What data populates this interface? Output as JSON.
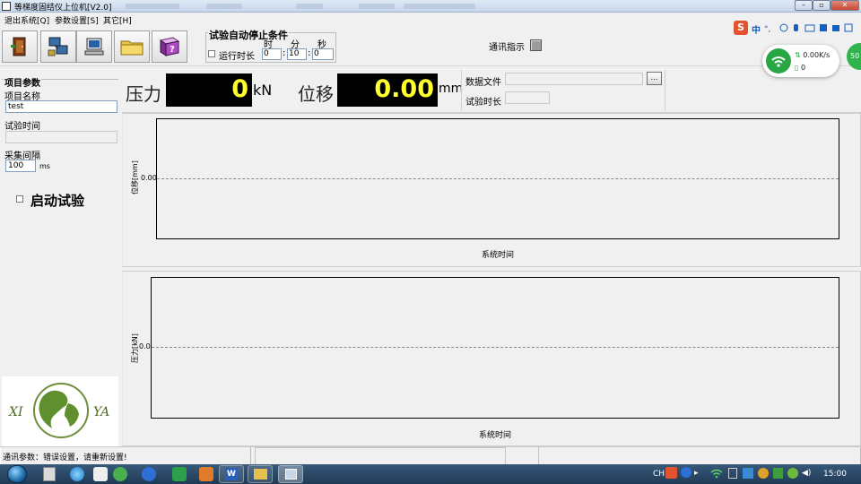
{
  "window": {
    "title": "等梯度固结仪上位机[V2.0]"
  },
  "menu": [
    {
      "label": "退出系统[Q]"
    },
    {
      "label": "参数设置[S]"
    },
    {
      "label": "其它[H]"
    }
  ],
  "toolbar": {
    "buttons": [
      {
        "icon": "exit-door-icon"
      },
      {
        "icon": "network-settings-icon"
      },
      {
        "icon": "computer-icon"
      },
      {
        "icon": "folder-icon"
      },
      {
        "icon": "help-book-icon"
      }
    ],
    "stop_condition": {
      "legend": "试验自动停止条件",
      "runtime_label": "运行时长",
      "hour_header": "时",
      "minute_header": "分",
      "second_header": "秒",
      "hour_value": "0",
      "minute_value": "10",
      "second_value": "0",
      "sep1": ":",
      "sep2": ":"
    },
    "comm_label": "通讯指示"
  },
  "tray_popup": {
    "ime_icon": "S",
    "ime_lang": "中",
    "upload_speed": "0.00K/s",
    "download_speed": "0",
    "ball_text": "50"
  },
  "project": {
    "legend": "项目参数",
    "name_label": "项目名称",
    "name_value": "test",
    "time_label": "试验时间",
    "time_value": "",
    "interval_label": "采集间隔",
    "interval_value": "100",
    "interval_unit": "ms",
    "start_label": "启动试验"
  },
  "readout": {
    "force_label": "压力",
    "force_value": "0",
    "force_unit": "kN",
    "disp_label": "位移",
    "disp_value": "0.00",
    "disp_unit": "mm"
  },
  "datafile": {
    "label": "数据文件",
    "value": "",
    "browse_label": "...",
    "duration_label": "试验时长",
    "duration_value": ""
  },
  "chart_data": [
    {
      "type": "line",
      "title": "",
      "xlabel": "系统时间",
      "ylabel": "位移[mm]",
      "yticks": [
        "0.00"
      ],
      "series": [],
      "grid": "dashed line at 0.00"
    },
    {
      "type": "line",
      "title": "",
      "xlabel": "系统时间",
      "ylabel": "压力[kN]",
      "yticks": [
        "0.0"
      ],
      "series": [],
      "grid": "dashed line at 0.0"
    }
  ],
  "status": {
    "message": "通讯参数：错误设置，请重新设置!"
  },
  "taskbar": {
    "lang": "CH",
    "clock": "15:00"
  }
}
